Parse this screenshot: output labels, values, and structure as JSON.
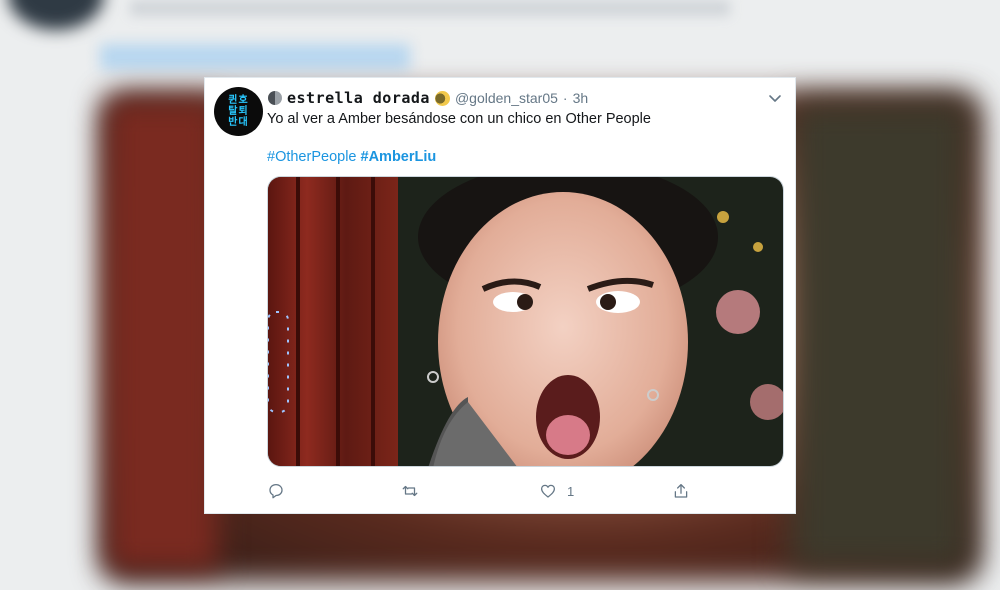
{
  "tweet": {
    "avatar_text": [
      "퀸호",
      "탈퇴",
      "반대"
    ],
    "display_name": "estrella dorada",
    "handle": "@golden_star05",
    "separator": "·",
    "time": "3h",
    "text": "Yo al ver a Amber besándose con un chico en Other People",
    "hashtags": [
      "#OtherPeople",
      "#AmberLiu"
    ],
    "like_count": "1"
  },
  "icons": {
    "emoji_1": "new-moon-face-icon",
    "emoji_2": "crescent-moon-icon",
    "menu": "chevron-down-icon",
    "reply": "reply-icon",
    "retweet": "retweet-icon",
    "like": "heart-icon",
    "share": "share-icon"
  },
  "colors": {
    "link": "#1b95e0",
    "text": "#14171a",
    "muted": "#657786",
    "avatar_text": "#28c8ff"
  }
}
